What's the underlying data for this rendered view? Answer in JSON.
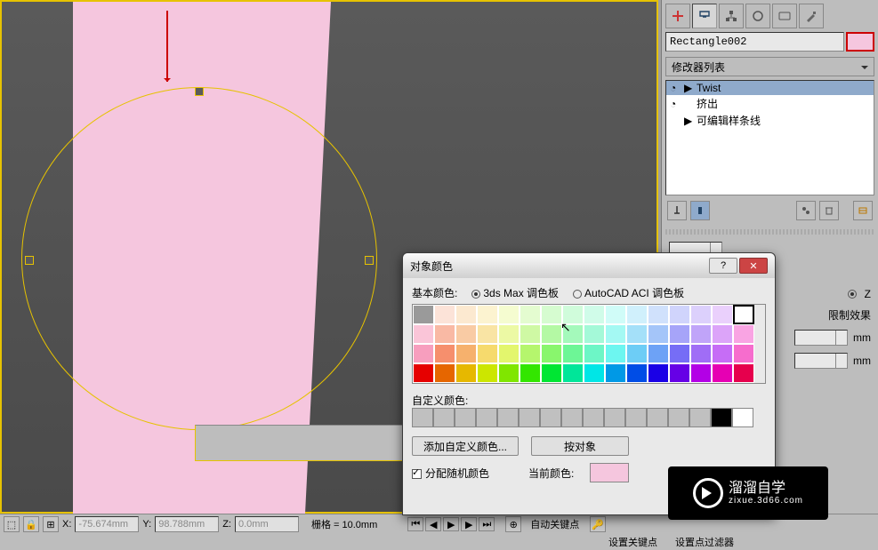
{
  "panel": {
    "object_name": "Rectangle002",
    "object_color": "#f5c6de",
    "modifier_dropdown": "修改器列表",
    "modifiers": [
      {
        "label": "Twist",
        "selected": true,
        "expander": "▶",
        "visible": true
      },
      {
        "label": "挤出",
        "selected": false,
        "expander": "",
        "visible": true
      },
      {
        "label": "可编辑样条线",
        "selected": false,
        "expander": "▶",
        "visible": false
      }
    ],
    "param_limit_label": "限制效果",
    "param_unit_suffix": "mm",
    "axis_z": "Z"
  },
  "coords": {
    "x_label": "X:",
    "x_value": "-75.674mm",
    "y_label": "Y:",
    "y_value": "98.788mm",
    "z_label": "Z:",
    "z_value": "0.0mm",
    "grid_label": "栅格 = 10.0mm",
    "autokey_label": "自动关键点",
    "setkey_label": "设置关键点",
    "filter_label": "设置点过滤器"
  },
  "dialog": {
    "title": "对象颜色",
    "basic_label": "基本颜色:",
    "palette_3dsmax": "3ds Max 调色板",
    "palette_autocad": "AutoCAD ACI 调色板",
    "custom_label": "自定义颜色:",
    "add_custom_btn": "添加自定义颜色...",
    "by_object_btn": "按对象",
    "random_label": "分配随机颜色",
    "current_label": "当前颜色:",
    "current_color": "#f5c6de",
    "basic_colors_row1": [
      "#9a9a9a",
      "#fce3d8",
      "#fce9d0",
      "#fcf3d0",
      "#f5fcd0",
      "#e4fcd0",
      "#d6fcd0",
      "#d0fcdb",
      "#d0fce9",
      "#d0fcf8",
      "#d0f0fc",
      "#d0e1fc",
      "#d0d4fc",
      "#dcd0fc",
      "#ead0fc",
      "#ffffff"
    ],
    "basic_colors_row2": [
      "#fac5d8",
      "#f9b9a4",
      "#f9cba4",
      "#f9e4a4",
      "#ecf9a4",
      "#cff9a4",
      "#b4f9a4",
      "#a4f9bb",
      "#a4f9d8",
      "#a4f9f3",
      "#a4e0f9",
      "#a4c5f9",
      "#a6a4f9",
      "#c0a4f9",
      "#dca4f9",
      "#f9a4e3"
    ],
    "basic_colors_row3": [
      "#f79ebe",
      "#f68f6d",
      "#f6b16d",
      "#f6da6d",
      "#e3f66d",
      "#b5f66d",
      "#89f66d",
      "#6df696",
      "#6df6c6",
      "#6df6f0",
      "#6dcdf6",
      "#6da2f6",
      "#766df6",
      "#a06df6",
      "#c66df6",
      "#f66dcd"
    ],
    "basic_colors_row4": [
      "#e60000",
      "#e66600",
      "#e6b800",
      "#cce600",
      "#80e600",
      "#33e600",
      "#00e633",
      "#00e699",
      "#00e6e6",
      "#0099e6",
      "#004de6",
      "#1a00e6",
      "#6600e6",
      "#b300e6",
      "#e600b3",
      "#e6004d"
    ],
    "selected_idx": 15
  },
  "watermark": {
    "brand": "溜溜自学",
    "url": "zixue.3d66.com"
  }
}
